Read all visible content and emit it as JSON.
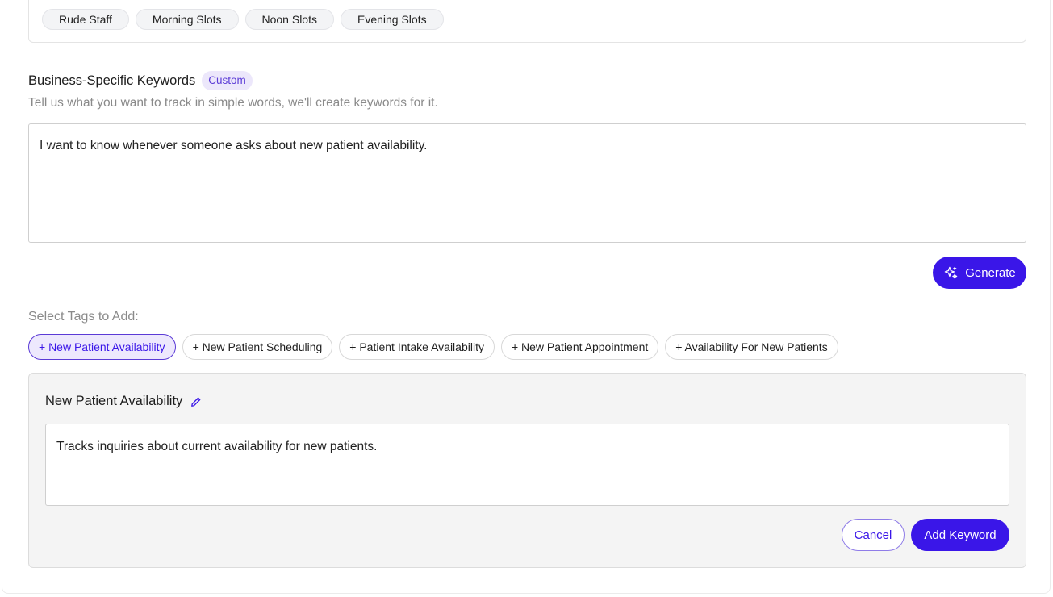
{
  "top_chips": [
    "Rude Staff",
    "Morning Slots",
    "Noon Slots",
    "Evening Slots"
  ],
  "business_keywords": {
    "title": "Business-Specific Keywords",
    "badge": "Custom",
    "subtitle": "Tell us what you want to track in simple words, we'll create keywords for it.",
    "input_value": "I want to know whenever someone asks about new patient availability.",
    "generate_label": "Generate"
  },
  "tags": {
    "label": "Select Tags to Add:",
    "items": [
      "+ New Patient Availability",
      "+ New Patient Scheduling",
      "+ Patient Intake Availability",
      "+ New Patient Appointment",
      "+ Availability For New Patients"
    ],
    "active_index": 0
  },
  "detail": {
    "title": "New Patient Availability",
    "description": "Tracks inquiries about current availability for new patients.",
    "cancel_label": "Cancel",
    "add_label": "Add Keyword"
  },
  "colors": {
    "accent": "#3a16e8",
    "badge_bg": "#ece7fb",
    "badge_text": "#5b3bd6"
  }
}
